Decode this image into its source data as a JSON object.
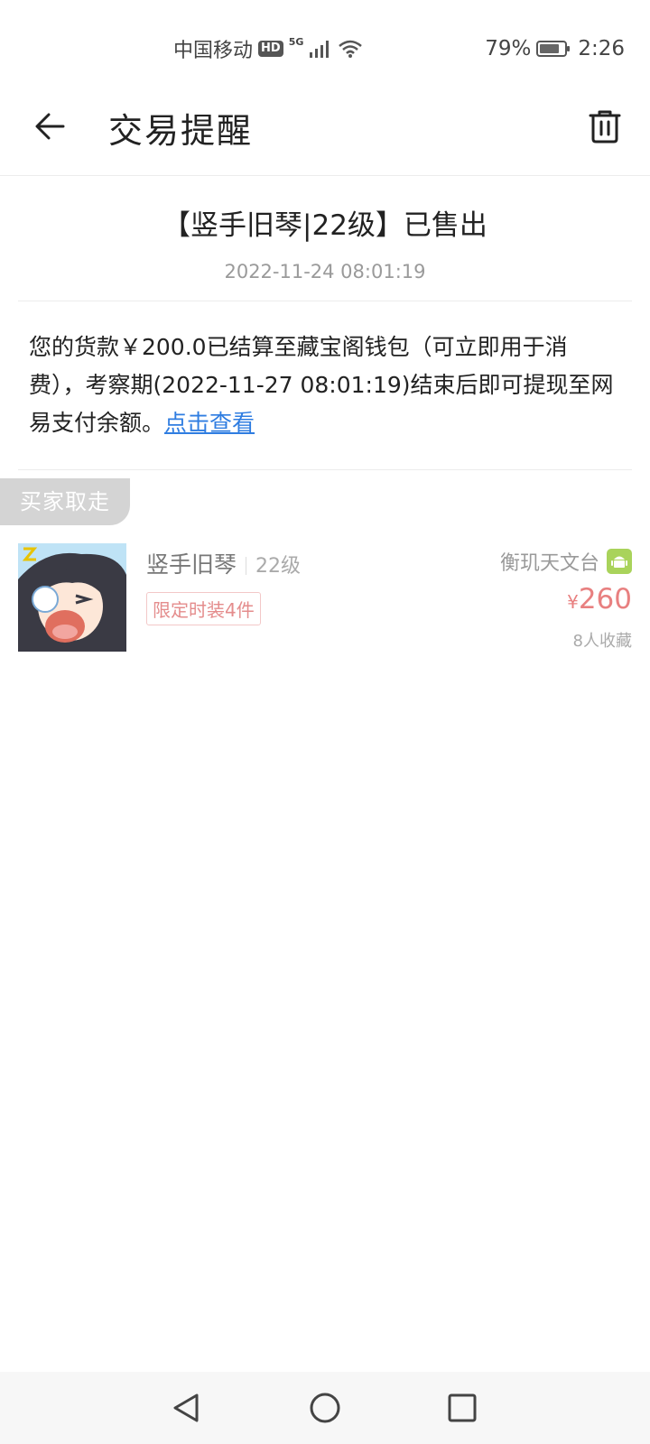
{
  "status_bar": {
    "carrier": "中国移动",
    "hd": "HD",
    "network": "5G",
    "battery_text": "79%",
    "battery_level": 0.79,
    "time": "2:26"
  },
  "header": {
    "title": "交易提醒"
  },
  "notice": {
    "title": "【竖手旧琴|22级】已售出",
    "time": "2022-11-24 08:01:19",
    "body": "您的货款￥200.0已结算至藏宝阁钱包（可立即用于消费），考察期(2022-11-27 08:01:19)结束后即可提现至网易支付余额。",
    "link": "点击查看"
  },
  "tag": {
    "label": "买家取走"
  },
  "listing": {
    "name": "竖手旧琴",
    "level": "22级",
    "badge": "限定时装4件",
    "server": "衡玑天文台",
    "price_symbol": "¥",
    "price": "260",
    "favorites": "8人收藏"
  },
  "colors": {
    "link": "#2f7de1",
    "price": "#e88080",
    "badge": "#e48c8c",
    "android": "#a9d35b"
  },
  "icons": [
    "back-arrow-icon",
    "trash-icon",
    "android-icon",
    "nav-back-icon",
    "nav-home-icon",
    "nav-recents-icon"
  ]
}
